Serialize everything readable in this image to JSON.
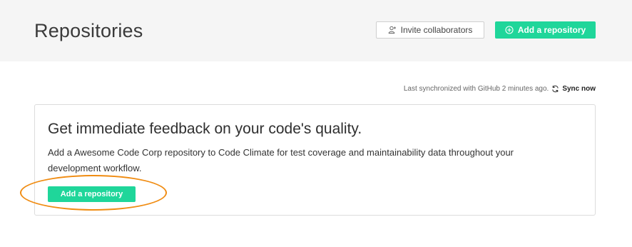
{
  "header": {
    "title": "Repositories",
    "invite_label": "Invite collaborators",
    "invite_icon": "user-add-icon",
    "add_repo_label": "Add a repository",
    "add_repo_icon": "plus-circle-icon"
  },
  "sync": {
    "status_text": "Last synchronized with GitHub 2 minutes ago.",
    "sync_label": "Sync now",
    "sync_icon": "refresh-icon"
  },
  "card": {
    "title": "Get immediate feedback on your code's quality.",
    "body": "Add a Awesome Code Corp repository to Code Climate for test coverage and maintainability data throughout your development workflow.",
    "button_label": "Add a repository"
  },
  "colors": {
    "accent": "#1fd69a",
    "header_bg": "#f5f5f5",
    "highlight": "#f08c12"
  }
}
